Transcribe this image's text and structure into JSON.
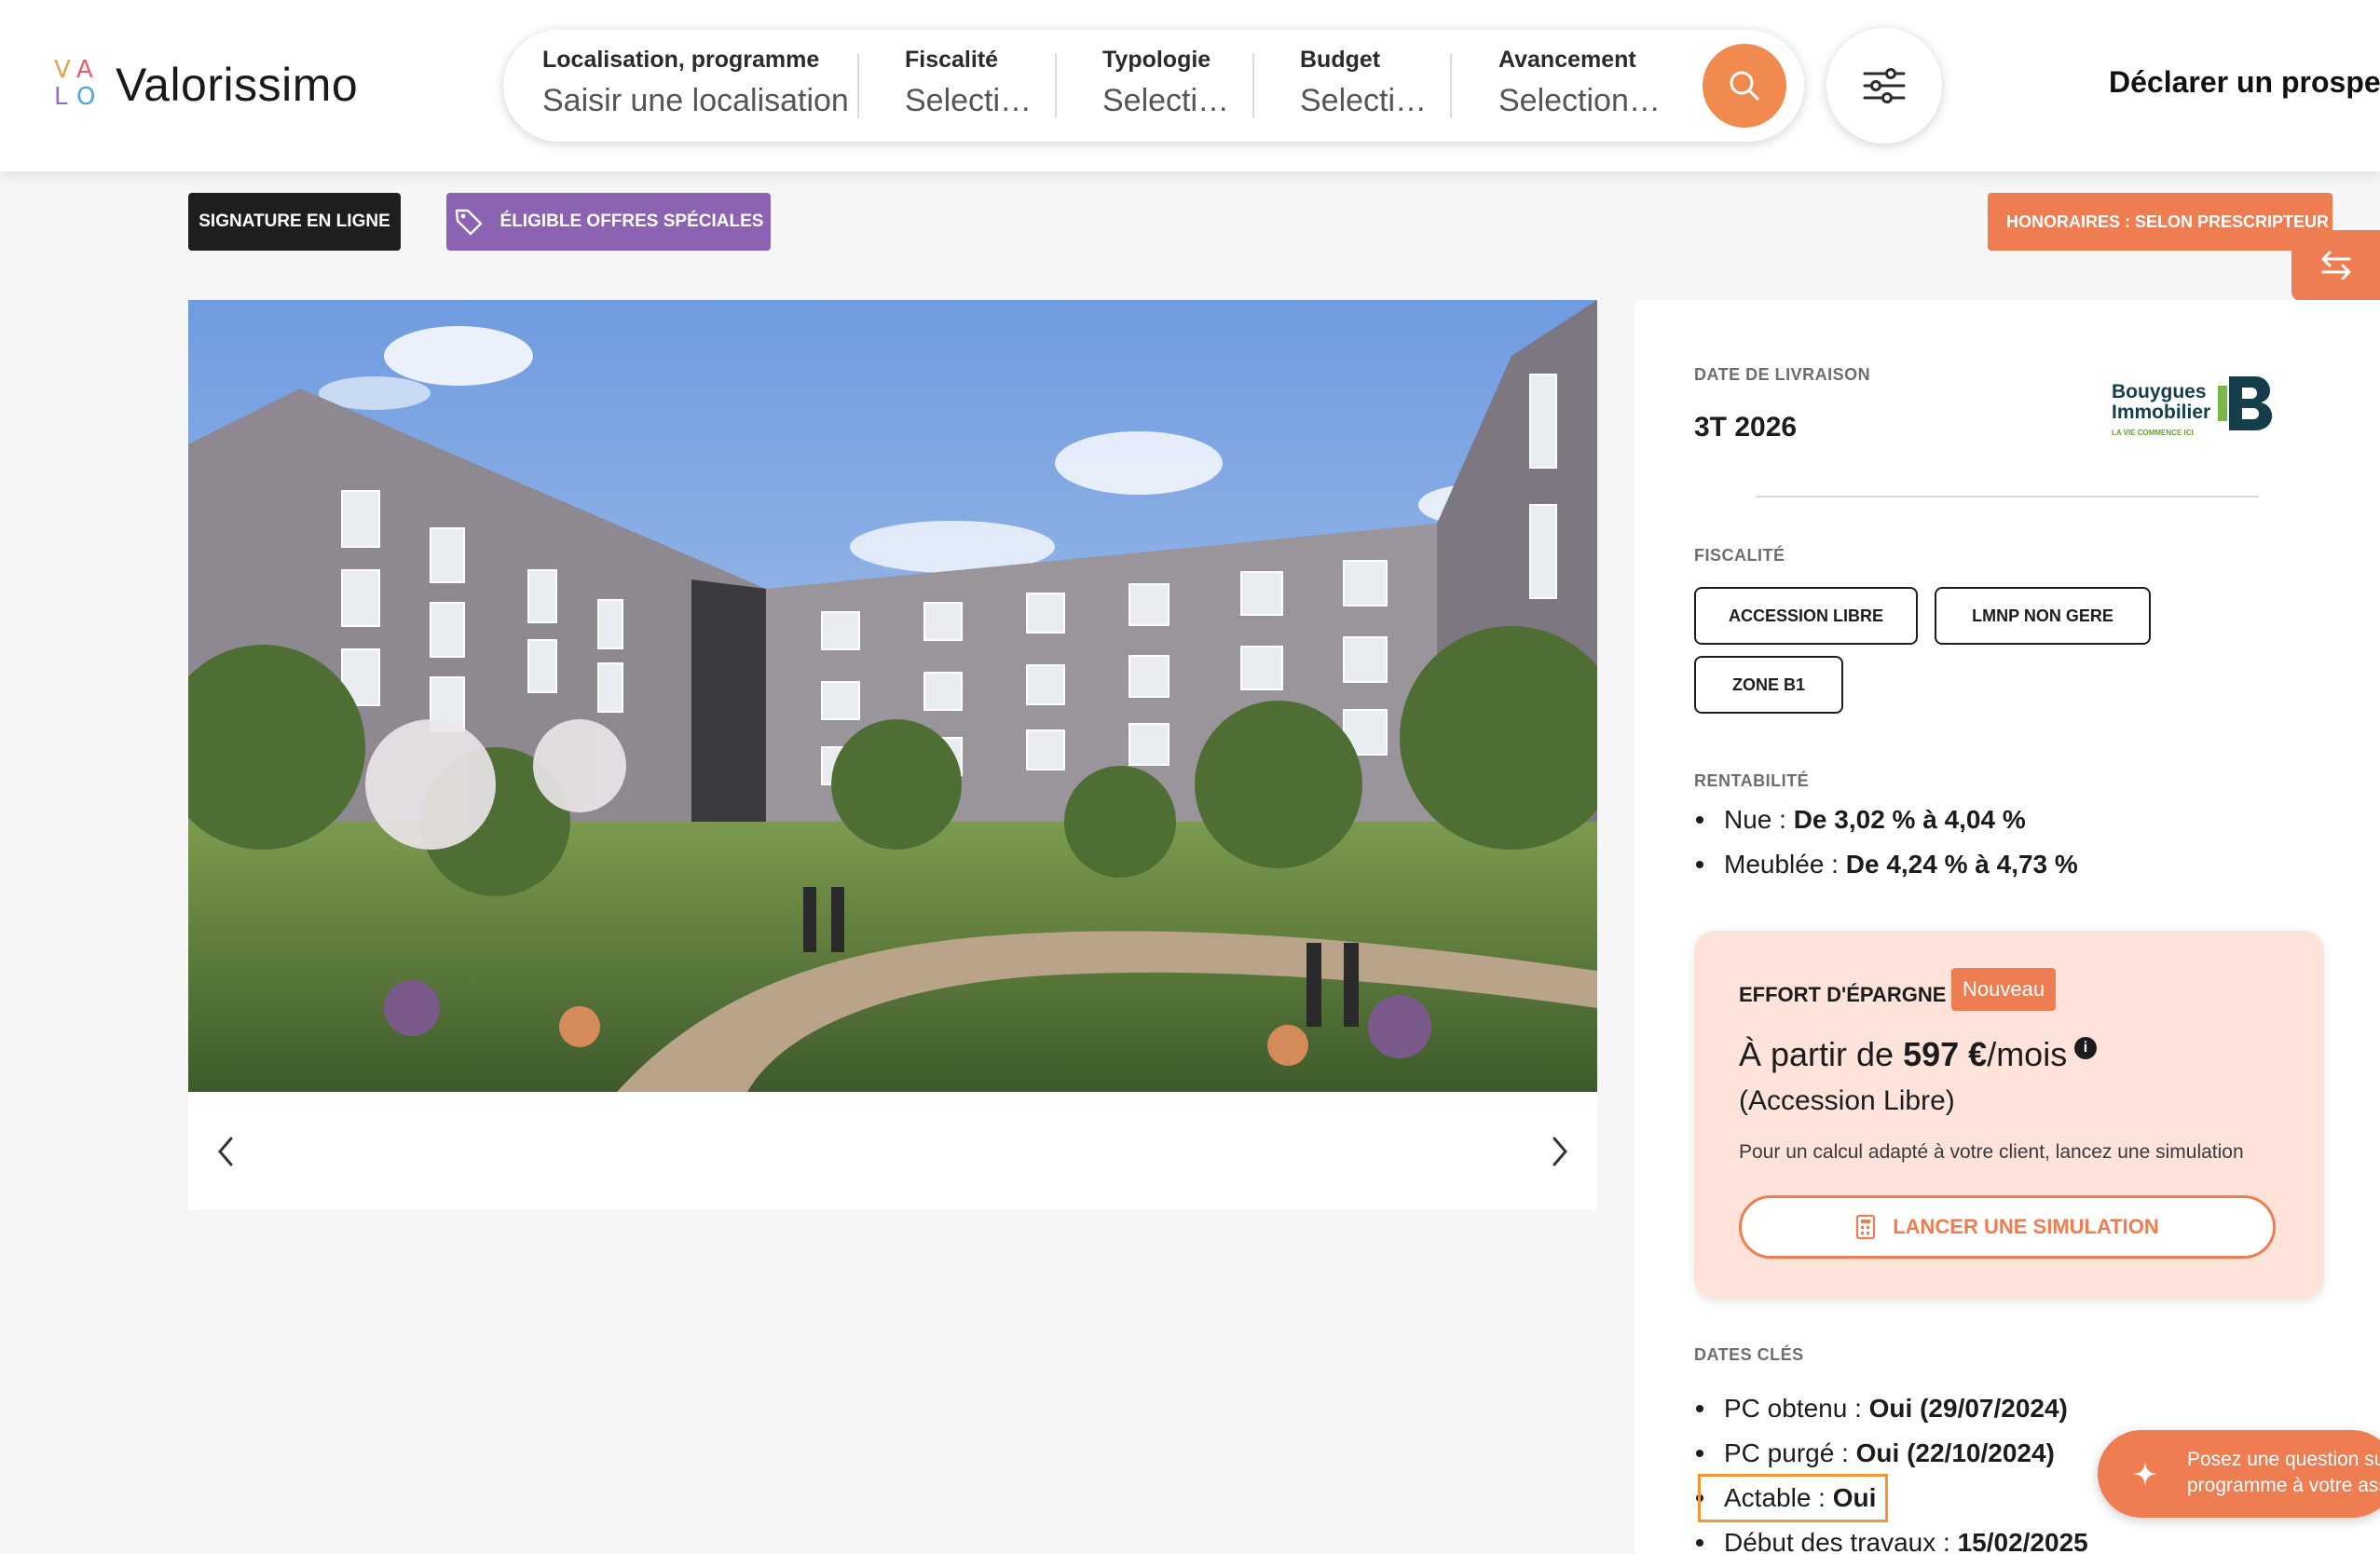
{
  "brand": {
    "logo_letters": [
      "V",
      "A",
      "L",
      "O"
    ],
    "name": "Valorissimo"
  },
  "search": {
    "location": {
      "label": "Localisation, programme",
      "placeholder": "Saisir une localisation"
    },
    "fiscalite": {
      "label": "Fiscalité",
      "value": "Selecti…"
    },
    "typologie": {
      "label": "Typologie",
      "value": "Selecti…"
    },
    "budget": {
      "label": "Budget",
      "value": "Selecti…"
    },
    "avancement": {
      "label": "Avancement",
      "value": "Selection…"
    },
    "search_icon": "search-icon",
    "filters_icon": "sliders-icon"
  },
  "header": {
    "declare_prospect": "Déclarer un prospect"
  },
  "badges": {
    "signature": "SIGNATURE EN LIGNE",
    "offres": "ÉLIGIBLE OFFRES SPÉCIALES",
    "honoraires": "HONORAIRES : SELON PRESCRIPTEUR"
  },
  "gallery": {
    "prev_icon": "chevron-left-icon",
    "next_icon": "chevron-right-icon"
  },
  "details": {
    "delivery_label": "DATE DE LIVRAISON",
    "delivery_value": "3T 2026",
    "promoter": {
      "line1": "Bouygues",
      "line2": "Immobilier",
      "tagline": "LA VIE COMMENCE ICI"
    },
    "fiscalite_label": "FISCALITÉ",
    "fiscalite_tags": [
      "ACCESSION LIBRE",
      "LMNP NON GERE",
      "ZONE B1"
    ],
    "rentabilite_label": "RENTABILITÉ",
    "rentabilite": [
      {
        "label": "Nue : ",
        "value": "De 3,02 % à 4,04 %"
      },
      {
        "label": "Meublée : ",
        "value": "De 4,24 % à 4,73 %"
      }
    ],
    "dates_label": "DATES CLÉS",
    "dates": [
      {
        "label": "PC obtenu : ",
        "value": "Oui (29/07/2024)"
      },
      {
        "label": "PC purgé : ",
        "value": "Oui (22/10/2024)"
      },
      {
        "label": "Actable : ",
        "value": "Oui"
      },
      {
        "label": "Début des travaux : ",
        "value": "15/02/2025"
      }
    ]
  },
  "epargne": {
    "title": "EFFORT D'ÉPARGNE",
    "badge": "Nouveau",
    "price_prefix": "À partir de ",
    "price_value": "597 €",
    "price_suffix": "/mois",
    "info": "i",
    "subtitle": "(Accession Libre)",
    "note": "Pour un calcul adapté à votre client, lancez une simulation",
    "button": "LANCER UNE SIMULATION"
  },
  "chat": {
    "line1": "Posez une question sur ce",
    "line2": "programme à votre assistant"
  },
  "colors": {
    "accent": "#ef7d52",
    "purple": "#8c62b2",
    "dark": "#1e1e1e",
    "epargne_bg": "#fde3d9",
    "highlight": "#f29734"
  }
}
